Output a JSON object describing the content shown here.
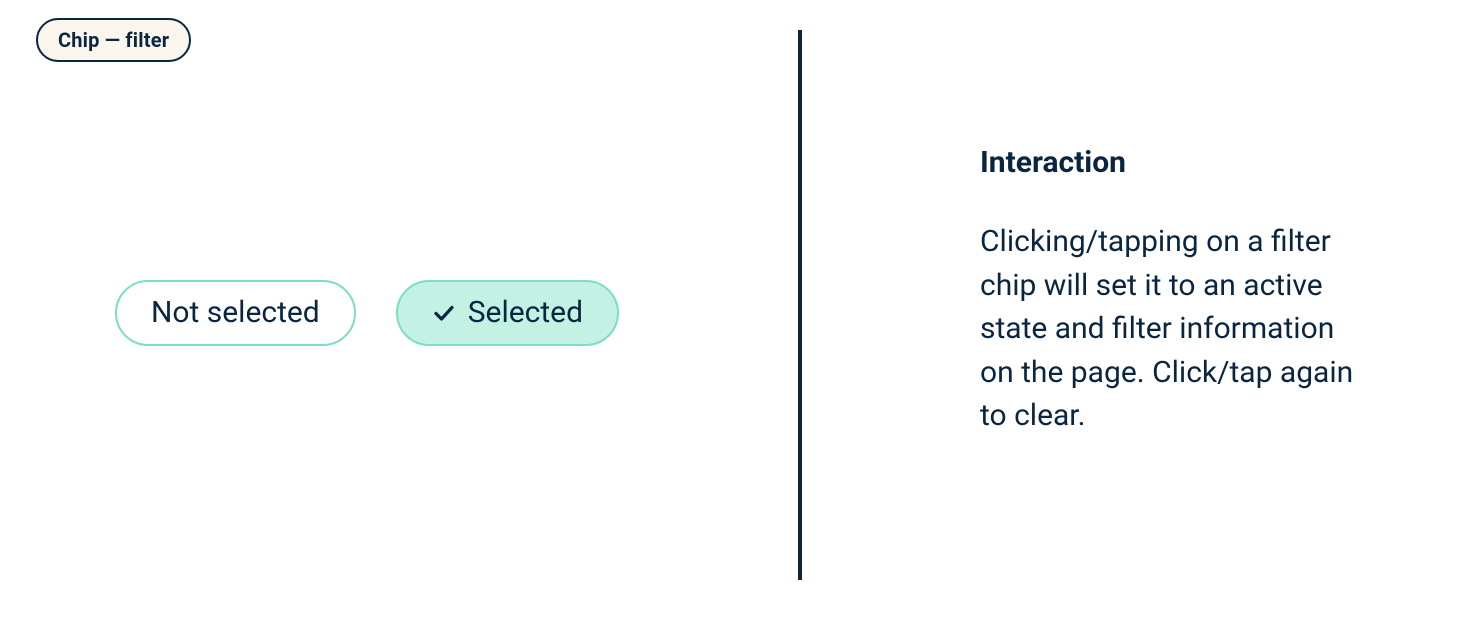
{
  "tag": {
    "label": "Chip — filter"
  },
  "chips": {
    "unselected_label": "Not selected",
    "selected_label": "Selected"
  },
  "info": {
    "heading": "Interaction",
    "body": "Clicking/tapping on a filter chip will set it to an active state and filter information on the page. Click/tap again to clear."
  }
}
